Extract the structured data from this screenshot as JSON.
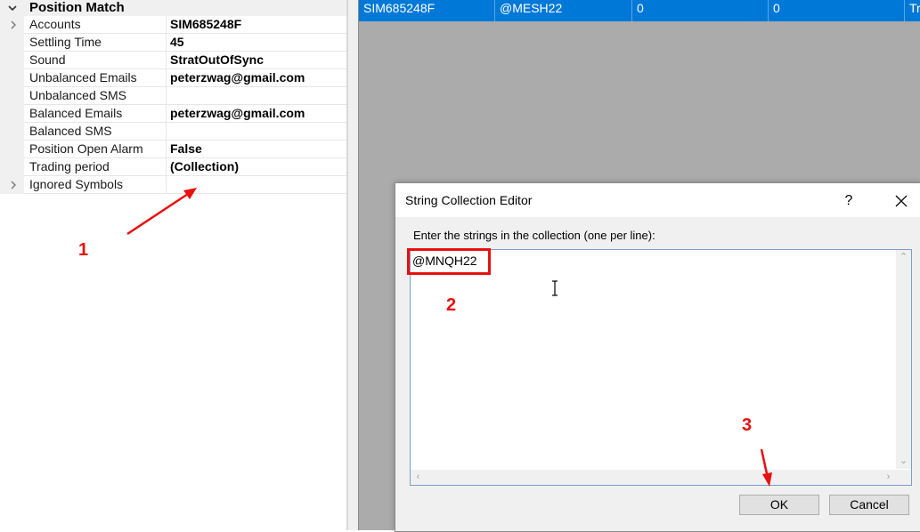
{
  "property_grid": {
    "category": "Position Match",
    "rows": [
      {
        "name": "Accounts",
        "value": "SIM685248F",
        "expandable": true
      },
      {
        "name": "Settling Time",
        "value": "45",
        "expandable": false
      },
      {
        "name": "Sound",
        "value": "StratOutOfSync",
        "expandable": false
      },
      {
        "name": "Unbalanced Emails",
        "value": "peterzwag@gmail.com",
        "expandable": false
      },
      {
        "name": "Unbalanced SMS",
        "value": "",
        "expandable": false
      },
      {
        "name": "Balanced Emails",
        "value": "peterzwag@gmail.com",
        "expandable": false
      },
      {
        "name": "Balanced SMS",
        "value": "",
        "expandable": false
      },
      {
        "name": "Position Open Alarm",
        "value": "False",
        "expandable": false
      },
      {
        "name": "Trading period",
        "value": "(Collection)",
        "expandable": false
      },
      {
        "name": "Ignored Symbols",
        "value": "",
        "expandable": true
      }
    ]
  },
  "grid_row": {
    "cells": [
      "SIM685248F",
      "@MESH22",
      "0",
      "0",
      "Tr"
    ]
  },
  "dialog": {
    "title": "String Collection Editor",
    "help_label": "?",
    "prompt": "Enter the strings in the collection (one per line):",
    "text_value": "@MNQH22",
    "ok_label": "OK",
    "cancel_label": "Cancel"
  },
  "annotations": {
    "step1": "1",
    "step2": "2",
    "step3": "3",
    "color": "#e81010"
  },
  "colors": {
    "selection": "#0078d7",
    "backdrop": "#ababab"
  }
}
